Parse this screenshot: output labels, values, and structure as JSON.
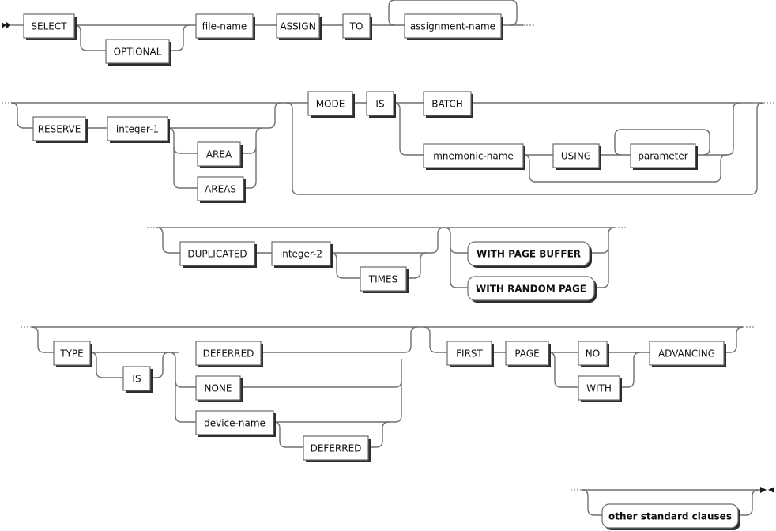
{
  "diagram": {
    "type": "railroad-syntax-diagram",
    "language": "COBOL",
    "rows": [
      {
        "name": "select-clause",
        "terms": [
          "SELECT",
          "OPTIONAL",
          "file-name",
          "ASSIGN",
          "TO",
          "assignment-name"
        ]
      },
      {
        "name": "reserve-mode",
        "terms": [
          "RESERVE",
          "integer-1",
          "AREA",
          "AREAS",
          "MODE",
          "IS",
          "BATCH",
          "mnemonic-name",
          "USING",
          "parameter"
        ]
      },
      {
        "name": "duplicated",
        "terms": [
          "DUPLICATED",
          "integer-2",
          "TIMES",
          "WITH PAGE BUFFER",
          "WITH RANDOM PAGE"
        ]
      },
      {
        "name": "type-first-page",
        "terms": [
          "TYPE",
          "IS",
          "DEFERRED",
          "NONE",
          "device-name",
          "DEFERRED",
          "FIRST",
          "PAGE",
          "NO",
          "WITH",
          "ADVANCING"
        ]
      },
      {
        "name": "other",
        "terms": [
          "other standard clauses"
        ]
      }
    ]
  },
  "t": {
    "select": "SELECT",
    "optional": "OPTIONAL",
    "file_name": "file-name",
    "assign": "ASSIGN",
    "to": "TO",
    "assignment_name": "assignment-name",
    "reserve": "RESERVE",
    "integer_1": "integer-1",
    "area": "AREA",
    "areas": "AREAS",
    "mode": "MODE",
    "is": "IS",
    "batch": "BATCH",
    "mnemonic_name": "mnemonic-name",
    "using": "USING",
    "parameter": "parameter",
    "duplicated": "DUPLICATED",
    "integer_2": "integer-2",
    "times": "TIMES",
    "with_page_buffer": "WITH PAGE BUFFER",
    "with_random_page": "WITH RANDOM PAGE",
    "type": "TYPE",
    "is2": "IS",
    "deferred": "DEFERRED",
    "none": "NONE",
    "device_name": "device-name",
    "deferred2": "DEFERRED",
    "first": "FIRST",
    "page": "PAGE",
    "no": "NO",
    "with": "WITH",
    "advancing": "ADVANCING",
    "other_standard_clauses": "other standard clauses"
  }
}
